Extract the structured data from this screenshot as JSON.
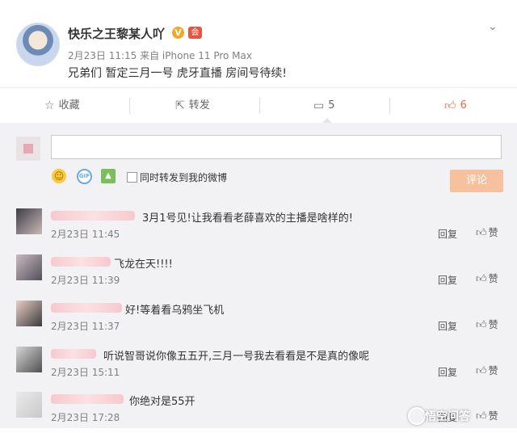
{
  "post": {
    "username": "快乐之王黎某人吖",
    "verified_mark": "V",
    "member_badge": "会",
    "meta": "2月23日 11:15 来自 iPhone 11 Pro Max",
    "content": "兄弟们 暂定三月一号 虎牙直播 房间号待续!",
    "more_icon": "chevron-down-icon"
  },
  "actions": {
    "favorite": {
      "icon": "star-icon",
      "label": "收藏"
    },
    "repost": {
      "icon": "repost-icon",
      "label": "转发"
    },
    "comment": {
      "icon": "comment-icon",
      "count": "5"
    },
    "like": {
      "icon": "thumbs-up-icon",
      "count": "6"
    }
  },
  "composer": {
    "forward_label": "同时转发到我的微博",
    "submit_label": "评论",
    "tools": [
      "emoji-icon",
      "gif-icon",
      "image-icon"
    ]
  },
  "comments": [
    {
      "text": "3月1号见!让我看看老薛喜欢的主播是啥样的!",
      "time": "2月23日 11:45",
      "reply": "回复",
      "like": "赞"
    },
    {
      "text": "飞龙在天!!!!",
      "time": "2月23日 11:39",
      "reply": "回复",
      "like": "赞"
    },
    {
      "text": "好!等着看乌鸦坐飞机",
      "time": "2月23日 11:37",
      "reply": "回复",
      "like": "赞"
    },
    {
      "text": "听说智哥说你像五五开,三月一号我去看看是不是真的像呢",
      "time": "2月23日 15:11",
      "reply": "回复",
      "like": "赞"
    },
    {
      "text": "你绝对是55开",
      "time": "2月23日 17:28",
      "reply": "回复",
      "like": "赞"
    }
  ],
  "watermark": "悟空问答"
}
